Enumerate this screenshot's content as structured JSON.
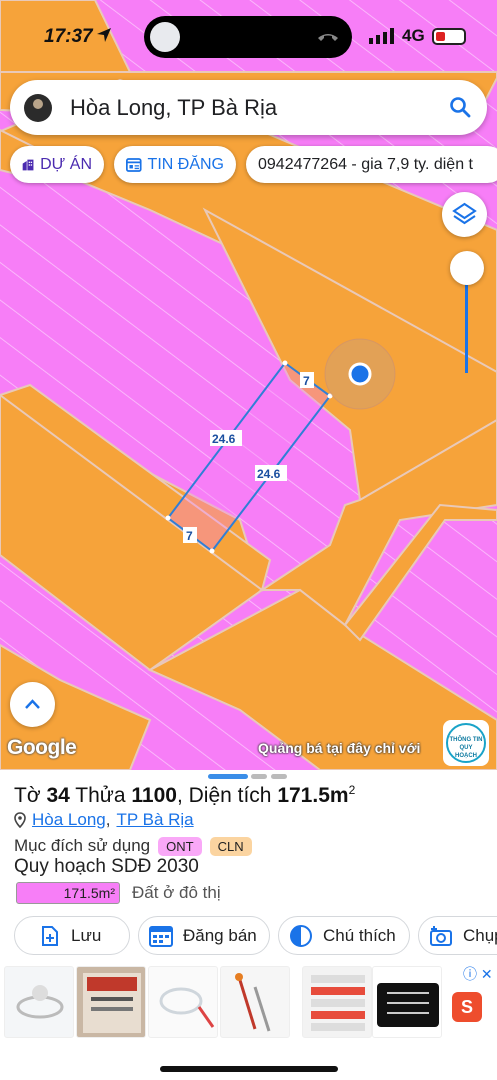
{
  "status_bar": {
    "time": "17:37",
    "network": "4G"
  },
  "search": {
    "query": "Hòa Long, TP Bà Rịa"
  },
  "chips": [
    {
      "label": "DỰ ÁN",
      "icon": "building-icon"
    },
    {
      "label": "TIN ĐĂNG",
      "icon": "listing-icon"
    },
    {
      "label": "0942477264 - gia 7,9 ty. diện t"
    }
  ],
  "map": {
    "edge_labels": [
      "7",
      "24.6",
      "24.6",
      "7"
    ],
    "logo": "Google",
    "ad_text": "Quảng bá tại đây chỉ với",
    "badge_text": "THÔNG TIN QUY HOẠCH",
    "colors": {
      "residential": "#f77ef7",
      "road": "#f6a33a",
      "parcel_line": "#2f7fd6",
      "location": "#1a73e8"
    }
  },
  "sheet": {
    "title": {
      "prefix": "Tờ",
      "sheet_no": "34",
      "parcel_label": "Thửa",
      "parcel_no": "1100",
      "area_text": ", Diện tích",
      "area": "171.5m",
      "unit_sup": "2"
    },
    "address": {
      "ward": "Hòa Long",
      "separator": ",",
      "city": "TP Bà Rịa"
    },
    "purpose": {
      "label": "Mục đích sử dụng",
      "tags": [
        "ONT",
        "CLN"
      ]
    },
    "plan_title": "Quy hoạch SDĐ 2030",
    "plan_area": "171.5m²",
    "plan_type": "Đất ở đô thị",
    "actions": [
      {
        "label": "Lưu",
        "icon": "add-note-icon"
      },
      {
        "label": "Đăng bán",
        "icon": "calendar-icon"
      },
      {
        "label": "Chú thích",
        "icon": "legend-icon"
      },
      {
        "label": "Chụp",
        "icon": "camera-icon"
      }
    ]
  }
}
